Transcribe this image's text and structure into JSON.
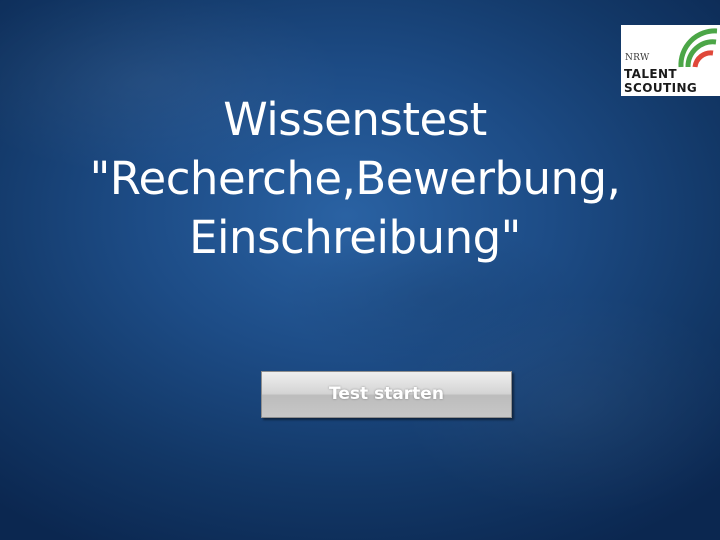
{
  "logo": {
    "line_small": "NRW",
    "line_1": "TALENT",
    "line_2": "SCOUTING",
    "arc_colors": [
      "#4ba647",
      "#4ba647",
      "#e0483a"
    ]
  },
  "title": {
    "line_1": "Wissenstest",
    "line_2": "\"Recherche,Bewerbung,",
    "line_3": "Einschreibung\""
  },
  "start_button": {
    "label": "Test starten"
  },
  "colors": {
    "background": "#1d4c86",
    "text": "#ffffff",
    "button_gray": "#c7c7c7"
  }
}
